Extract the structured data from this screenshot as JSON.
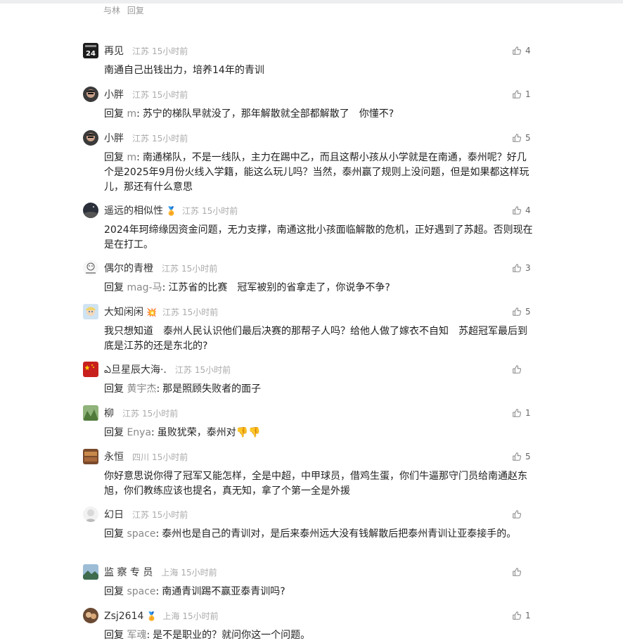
{
  "prev_reply": {
    "author_fragment": "与林",
    "reply_label": "回复"
  },
  "comments": [
    {
      "name": "再见",
      "badge": "",
      "location": "江苏",
      "time": "15小时前",
      "likes": "4",
      "reply_label": "",
      "reply_to": "",
      "text": "南通自己出钱出力，培养14年的青训"
    },
    {
      "name": "小胖",
      "badge": "",
      "location": "江苏",
      "time": "15小时前",
      "likes": "1",
      "reply_label": "回复",
      "reply_to": "m",
      "text": "苏宁的梯队早就没了，那年解散就全部都解散了　你懂不?"
    },
    {
      "name": "小胖",
      "badge": "",
      "location": "江苏",
      "time": "15小时前",
      "likes": "5",
      "reply_label": "回复",
      "reply_to": "m",
      "text": "南通梯队，不是一线队，主力在踢中乙，而且这帮小孩从小学就是在南通，泰州呢？好几个是2025年9月份火线入学籍，能这么玩儿吗？当然，泰州赢了规则上没问题，但是如果都这样玩儿，那还有什么意思"
    },
    {
      "name": "遥远的相似性",
      "badge": "🏅",
      "location": "江苏",
      "time": "15小时前",
      "likes": "4",
      "reply_label": "",
      "reply_to": "",
      "text": "2024年珂缔缘因资金问题，无力支撑，南通这批小孩面临解散的危机，正好遇到了苏超。否则现在是在打工。"
    },
    {
      "name": "偶尔的青橙",
      "badge": "",
      "location": "江苏",
      "time": "15小时前",
      "likes": "3",
      "reply_label": "回复",
      "reply_to": "mag-马",
      "text": "江苏省的比赛　冠军被别的省拿走了，你说争不争?"
    },
    {
      "name": "大知闲闲",
      "badge": "💥",
      "location": "江苏",
      "time": "15小时前",
      "likes": "5",
      "reply_label": "",
      "reply_to": "",
      "text": "我只想知道　泰州人民认识他们最后决赛的那帮子人吗？给他人做了嫁衣不自知　苏超冠军最后到底是江苏的还是东北的?"
    },
    {
      "name": "ఎ旦星辰大海·.",
      "badge": "",
      "location": "江苏",
      "time": "15小时前",
      "likes": "",
      "reply_label": "回复",
      "reply_to": "黄宇杰",
      "text": "那是照顾失败者的面子"
    },
    {
      "name": "柳",
      "badge": "",
      "location": "江苏",
      "time": "15小时前",
      "likes": "1",
      "reply_label": "回复",
      "reply_to": "Enya",
      "text": "虽败犹荣，泰州对👎👎"
    },
    {
      "name": "永恒",
      "badge": "",
      "location": "四川",
      "time": "15小时前",
      "likes": "5",
      "reply_label": "",
      "reply_to": "",
      "text": "你好意思说你得了冠军又能怎样，全是中超，中甲球员，借鸡生蛋，你们牛逼那守门员给南通赵东旭，你们教练应该也提名，真无知，拿了个第一全是外援"
    },
    {
      "name": "幻日",
      "badge": "",
      "location": "江苏",
      "time": "15小时前",
      "likes": "",
      "reply_label": "回复",
      "reply_to": "space",
      "text": "泰州也是自己的青训对，是后来泰州远大没有钱解散后把泰州青训让亚泰接手的。"
    },
    {
      "name": "监 察 专 员",
      "badge": "",
      "location": "上海",
      "time": "15小时前",
      "likes": "",
      "reply_label": "回复",
      "reply_to": "space",
      "text": "南通青训踢不赢亚泰青训吗?"
    },
    {
      "name": "Zsj2614",
      "badge": "🏅",
      "location": "上海",
      "time": "15小时前",
      "likes": "1",
      "reply_label": "回复",
      "reply_to": "军魂",
      "text": "是不是职业的？就问你这一个问题。"
    }
  ],
  "colors": {
    "name": "#333333",
    "meta": "#aaaaaa",
    "mention": "#888888",
    "like_icon": "#888888"
  }
}
